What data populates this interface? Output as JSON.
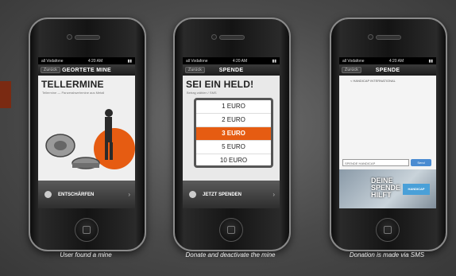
{
  "phone1": {
    "status_left": "all Vodafone",
    "status_time": "4:20 AM",
    "status_right": "▮▮",
    "nav_back": "Zurück",
    "nav_title": "GEORTETE MINE",
    "title": "TELLERMINE",
    "subtitle": "Tellermine — Panzerabwehrmine aus Metall",
    "bottom_label": "ENTSCHÄRFEN",
    "caption": "User found a mine"
  },
  "phone2": {
    "status_left": "all Vodafone",
    "status_time": "4:20 AM",
    "status_right": "▮▮",
    "nav_back": "Zurück",
    "nav_title": "SPENDE",
    "title": "SEI EIN HELD!",
    "subtitle": "Betrag wählen / SMS",
    "picker_options": [
      "1 EURO",
      "2 EURO",
      "3 EURO",
      "5 EURO",
      "10 EURO"
    ],
    "picker_selected_index": 2,
    "bottom_label": "JETZT SPENDEN",
    "caption": "Donate and deactivate the mine"
  },
  "phone3": {
    "status_left": "all Vodafone",
    "status_time": "4:20 AM",
    "status_right": "▮▮",
    "nav_back": "Zurück",
    "nav_title": "SPENDE",
    "message_header": "< HANDICAP INTERNATIONAL",
    "input_text": "SPENDE HANDICAP",
    "send_label": "Send",
    "banner_text": "DEINE SPENDE HILFT",
    "logo_text": "HANDICAP",
    "caption": "Donation is made via SMS"
  },
  "colors": {
    "accent_orange": "#e65c12",
    "brand_brown": "#7a2a12"
  }
}
